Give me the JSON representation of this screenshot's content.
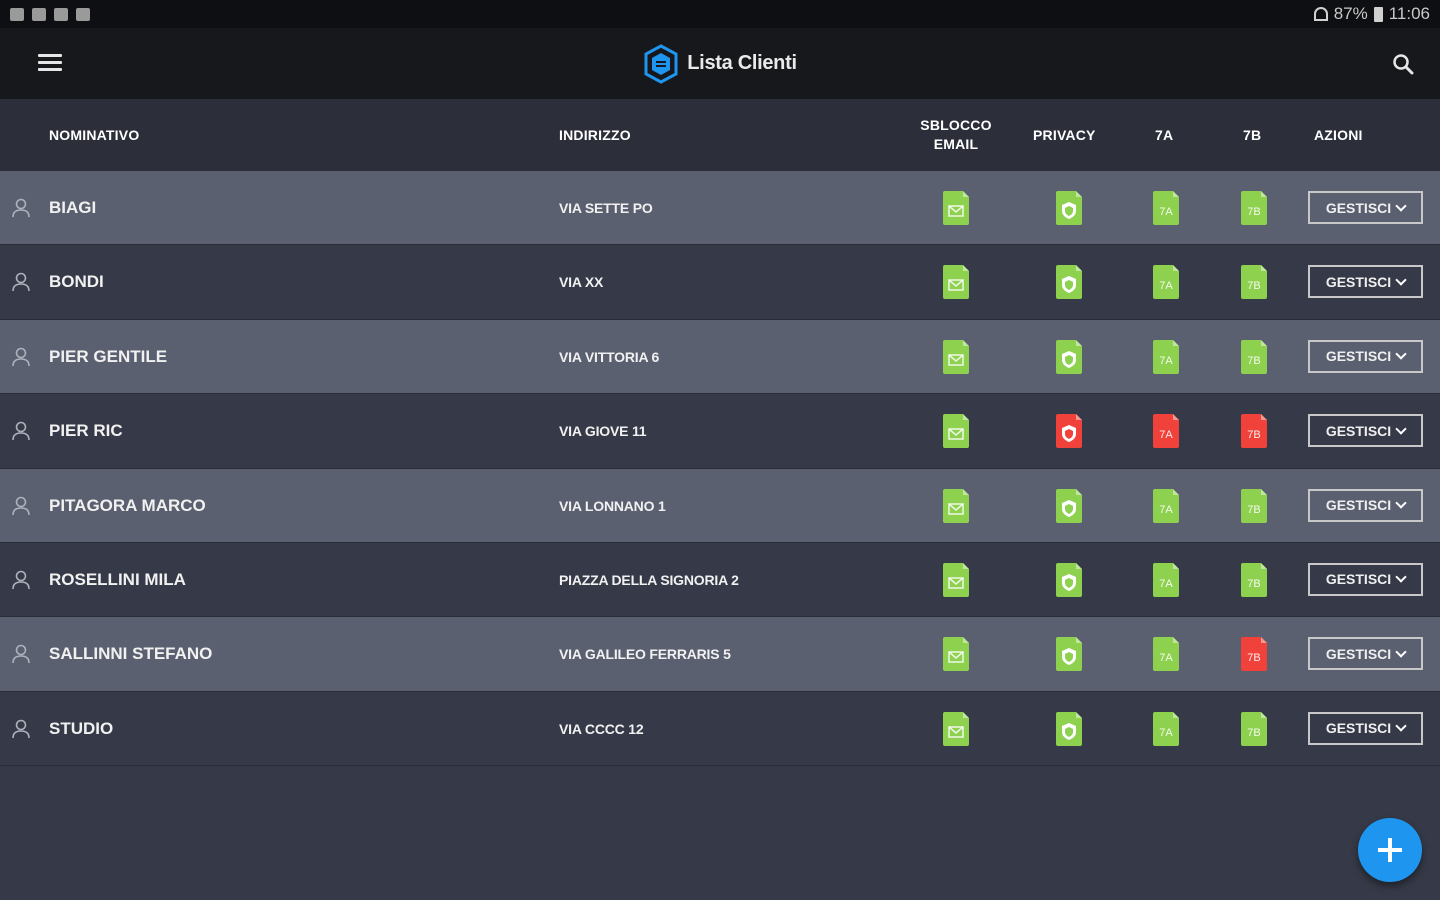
{
  "status_bar": {
    "battery": "87%",
    "time": "11:06"
  },
  "app_bar": {
    "title": "Lista Clienti"
  },
  "table": {
    "headers": {
      "name": "NOMINATIVO",
      "address": "INDIRIZZO",
      "email_unlock_line1": "SBLOCCO",
      "email_unlock_line2": "EMAIL",
      "privacy": "PRIVACY",
      "col_7a": "7A",
      "col_7b": "7B",
      "actions": "AZIONI"
    },
    "rows": [
      {
        "name": "BIAGI",
        "address": "VIA SETTE PO",
        "email": "green",
        "privacy": "green",
        "a7": "green",
        "b7": "green",
        "action": "GESTISCI"
      },
      {
        "name": "BONDI",
        "address": "VIA XX",
        "email": "green",
        "privacy": "green",
        "a7": "green",
        "b7": "green",
        "action": "GESTISCI"
      },
      {
        "name": "PIER GENTILE",
        "address": "VIA VITTORIA 6",
        "email": "green",
        "privacy": "green",
        "a7": "green",
        "b7": "green",
        "action": "GESTISCI"
      },
      {
        "name": "PIER RIC",
        "address": "VIA GIOVE 11",
        "email": "green",
        "privacy": "red",
        "a7": "red",
        "b7": "red",
        "action": "GESTISCI"
      },
      {
        "name": "PITAGORA MARCO",
        "address": "VIA LONNANO 1",
        "email": "green",
        "privacy": "green",
        "a7": "green",
        "b7": "green",
        "action": "GESTISCI"
      },
      {
        "name": "ROSELLINI MILA",
        "address": "PIAZZA DELLA SIGNORIA 2",
        "email": "green",
        "privacy": "green",
        "a7": "green",
        "b7": "green",
        "action": "GESTISCI"
      },
      {
        "name": "SALLINNI STEFANO",
        "address": "VIA GALILEO FERRARIS 5",
        "email": "green",
        "privacy": "green",
        "a7": "green",
        "b7": "red",
        "action": "GESTISCI"
      },
      {
        "name": "STUDIO",
        "address": "VIA CCCC 12",
        "email": "green",
        "privacy": "green",
        "a7": "green",
        "b7": "green",
        "action": "GESTISCI"
      }
    ]
  },
  "colors": {
    "green": "#8dd14f",
    "red": "#f0423a",
    "accent": "#1e96f0"
  },
  "icons": {
    "menu": "menu-icon",
    "logo": "shield-logo-icon",
    "search": "search-icon",
    "person": "person-icon",
    "fab": "plus-icon"
  }
}
